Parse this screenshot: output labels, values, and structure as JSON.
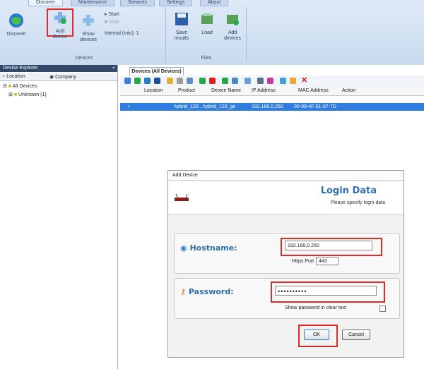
{
  "ribbon": {
    "tabs": [
      "Discover",
      "Maintenance",
      "Services",
      "Settings",
      "About"
    ],
    "buttons": {
      "discover": "Discover",
      "add_device": "Add device",
      "show_devices": "Show devices",
      "start": "Start",
      "stop": "Stop",
      "interval": "Interval (min): 1",
      "save_results": "Save results",
      "load": "Load",
      "add_devices": "Add devices"
    },
    "groups": {
      "devices": "Devices",
      "files": "Files"
    }
  },
  "left": {
    "title": "Device Explorer",
    "radio_location": "Location",
    "radio_company": "Company",
    "tree": [
      "All Devices",
      "Unknown (1)"
    ]
  },
  "devices": {
    "tab": "Devices (All Devices)",
    "columns": [
      "Location",
      "Product",
      "Device Name",
      "IP Address",
      "MAC Address",
      "Action"
    ],
    "row": {
      "product": "hybrid_120...",
      "device_name": "hybrid_120_ge",
      "ip": "192.168.0.250",
      "mac": "00-09-4F-61-07-7D"
    }
  },
  "dialog": {
    "title": "Add Device",
    "heading": "Login Data",
    "subtitle": "Please specify login data",
    "hostname_label": "Hostname:",
    "hostname_value": "192.168.0.250",
    "https_port_label": "Https Port",
    "https_port_value": "443",
    "password_label": "Password:",
    "password_value": "••••••••••",
    "show_password": "Show password in clear text",
    "ok": "OK",
    "cancel": "Cancel"
  },
  "colors": {
    "accent": "#2d6fb0",
    "highlight": "#e02a2a",
    "selected_row": "#2f7de1"
  }
}
